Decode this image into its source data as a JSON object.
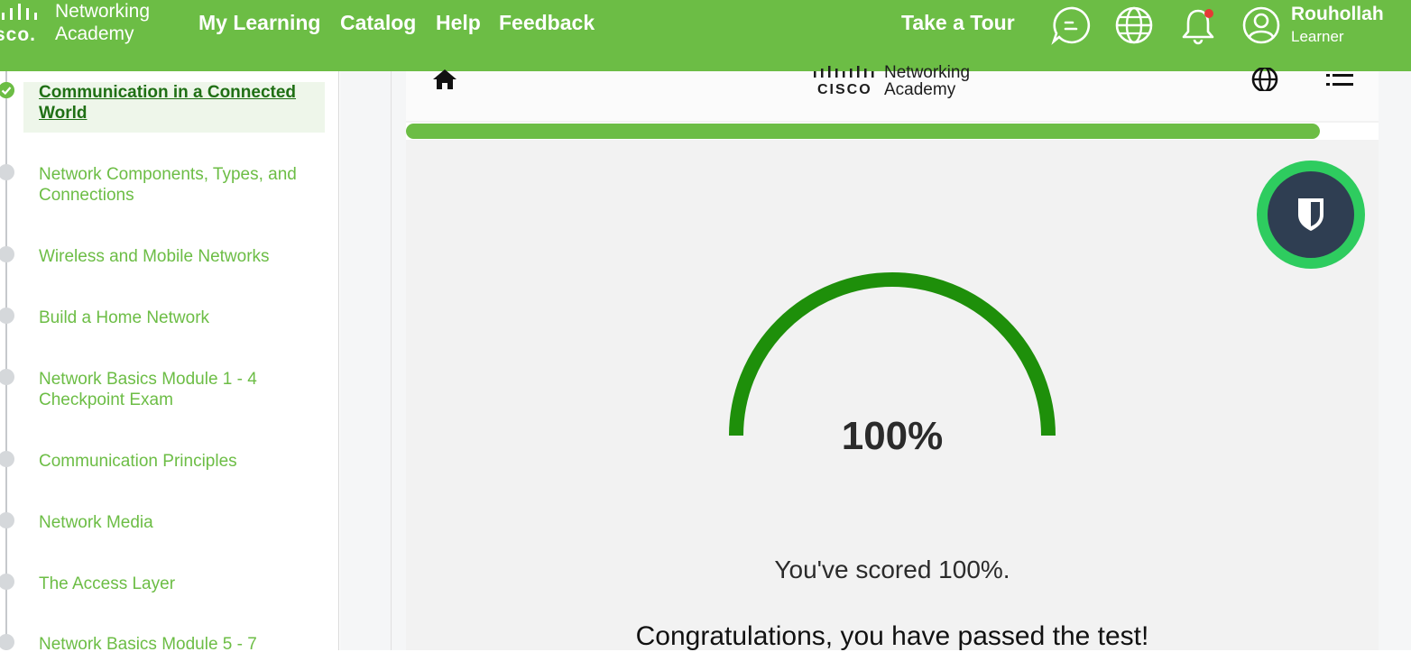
{
  "header": {
    "brand": {
      "cisco": "sco.",
      "line1": "Networking",
      "line2": "Academy"
    },
    "nav": [
      "My Learning",
      "Catalog",
      "Help",
      "Feedback"
    ],
    "tour": "Take a Tour",
    "icons": [
      "chat-icon",
      "globe-icon",
      "bell-icon",
      "user-avatar-icon"
    ],
    "notification_color": "#e53935",
    "user": {
      "name": "Rouhollah",
      "role": "Learner"
    }
  },
  "sidebar": {
    "items": [
      {
        "label": "Communication in a Connected World",
        "state": "completed"
      },
      {
        "label": "Network Components, Types, and Connections"
      },
      {
        "label": "Wireless and Mobile Networks"
      },
      {
        "label": "Build a Home Network"
      },
      {
        "label": "Network Basics Module 1 - 4 Checkpoint Exam"
      },
      {
        "label": "Communication Principles"
      },
      {
        "label": "Network Media"
      },
      {
        "label": "The Access Layer"
      },
      {
        "label": "Network Basics Module 5 - 7"
      }
    ]
  },
  "content": {
    "logo": {
      "cisco": "CISCO",
      "line1": "Networking",
      "line2": "Academy"
    },
    "progress": 0.94,
    "score": {
      "percent": "100%",
      "value": 100,
      "message": "You've scored 100%.",
      "result": "Congratulations, you have passed the test!"
    }
  },
  "colors": {
    "brand_green": "#6cbd45",
    "gauge_green": "#1e8f0a",
    "bitwarden_ring": "#2ecc5f",
    "bitwarden_core": "#2f3e52"
  }
}
